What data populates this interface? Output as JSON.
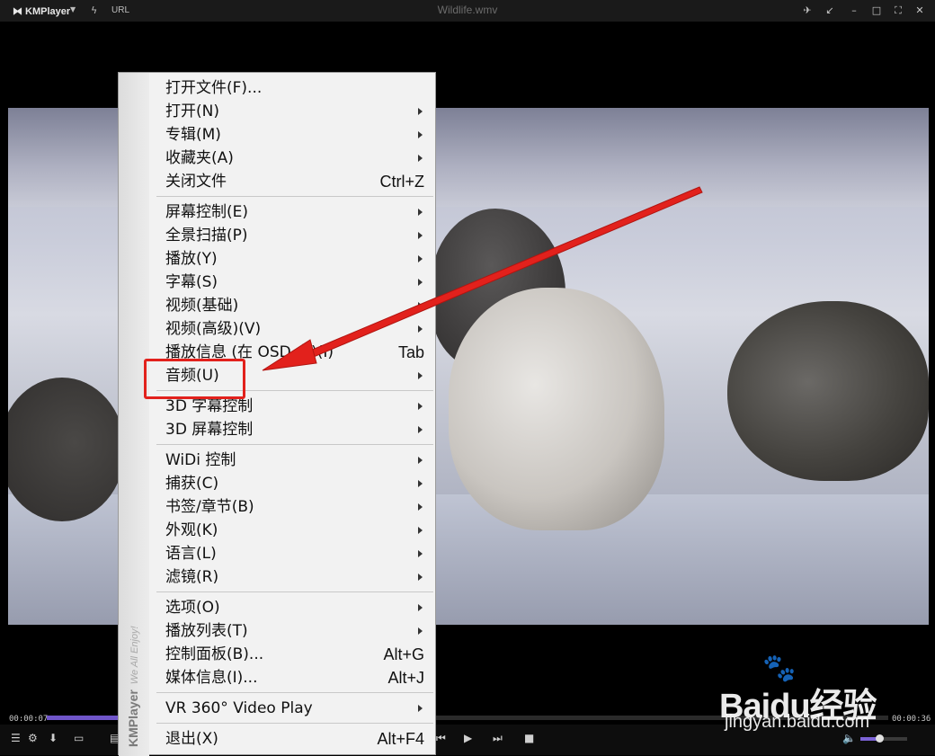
{
  "titlebar": {
    "app_name": "KMPlayer",
    "url_label": "URL",
    "window_title": "Wildlife.wmv"
  },
  "player": {
    "time_elapsed": "00:00:07",
    "time_total": "00:00:36",
    "progress_fraction": 0.16,
    "volume_fraction": 0.4
  },
  "menu": {
    "side_brand": "KMPlayer",
    "side_tagline": "We All Enjoy!",
    "groups": [
      [
        {
          "label": "打开文件(F)...",
          "shortcut": "",
          "submenu": false
        },
        {
          "label": "打开(N)",
          "shortcut": "",
          "submenu": true
        },
        {
          "label": "专辑(M)",
          "shortcut": "",
          "submenu": true
        },
        {
          "label": "收藏夹(A)",
          "shortcut": "",
          "submenu": true
        },
        {
          "label": "关闭文件",
          "shortcut": "Ctrl+Z",
          "submenu": false
        }
      ],
      [
        {
          "label": "屏幕控制(E)",
          "shortcut": "",
          "submenu": true
        },
        {
          "label": "全景扫描(P)",
          "shortcut": "",
          "submenu": true
        },
        {
          "label": "播放(Y)",
          "shortcut": "",
          "submenu": true
        },
        {
          "label": "字幕(S)",
          "shortcut": "",
          "submenu": true
        },
        {
          "label": "视频(基础)",
          "shortcut": "",
          "submenu": true
        },
        {
          "label": "视频(高级)(V)",
          "shortcut": "",
          "submenu": true
        },
        {
          "label": "播放信息 (在 OSD 上)(I)",
          "shortcut": "Tab",
          "submenu": false
        },
        {
          "label": "音频(U)",
          "shortcut": "",
          "submenu": true
        }
      ],
      [
        {
          "label": "3D 字幕控制",
          "shortcut": "",
          "submenu": true
        },
        {
          "label": "3D 屏幕控制",
          "shortcut": "",
          "submenu": true
        }
      ],
      [
        {
          "label": "WiDi 控制",
          "shortcut": "",
          "submenu": true
        },
        {
          "label": "捕获(C)",
          "shortcut": "",
          "submenu": true
        },
        {
          "label": "书签/章节(B)",
          "shortcut": "",
          "submenu": true
        },
        {
          "label": "外观(K)",
          "shortcut": "",
          "submenu": true
        },
        {
          "label": "语言(L)",
          "shortcut": "",
          "submenu": true
        },
        {
          "label": "滤镜(R)",
          "shortcut": "",
          "submenu": true
        }
      ],
      [
        {
          "label": "选项(O)",
          "shortcut": "",
          "submenu": true
        },
        {
          "label": "播放列表(T)",
          "shortcut": "",
          "submenu": true
        },
        {
          "label": "控制面板(B)...",
          "shortcut": "Alt+G",
          "submenu": false
        },
        {
          "label": "媒体信息(I)...",
          "shortcut": "Alt+J",
          "submenu": false
        }
      ],
      [
        {
          "label": "VR 360° Video Play",
          "shortcut": "",
          "submenu": true
        }
      ],
      [
        {
          "label": "退出(X)",
          "shortcut": "Alt+F4",
          "submenu": false
        }
      ]
    ]
  },
  "watermark": {
    "brand": "Baidu经验",
    "site": "jingyan.baidu.com"
  },
  "colors": {
    "accent": "#6f55c9",
    "annotation": "#e2211c"
  }
}
